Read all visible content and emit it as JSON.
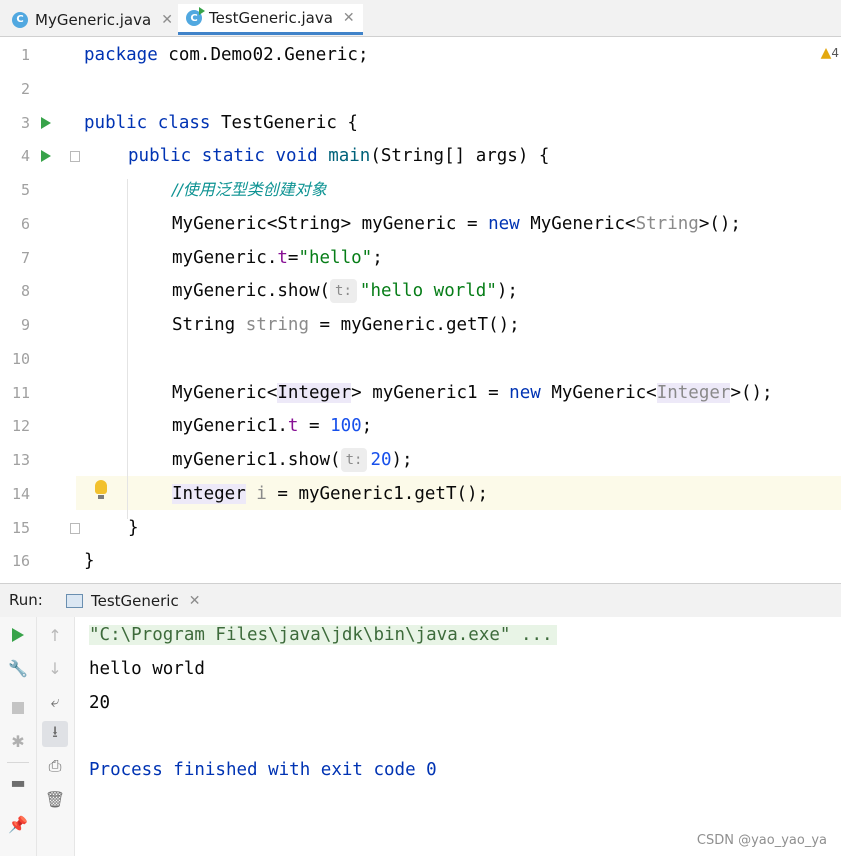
{
  "tabs": [
    {
      "label": "MyGeneric.java",
      "icon": "class-c-icon",
      "active": false
    },
    {
      "label": "TestGeneric.java",
      "icon": "runnable-class-icon",
      "active": true
    }
  ],
  "editor": {
    "warning_count": "4",
    "line_numbers": [
      "1",
      "2",
      "3",
      "4",
      "5",
      "6",
      "7",
      "8",
      "9",
      "10",
      "11",
      "12",
      "13",
      "14",
      "15",
      "16"
    ],
    "line1": {
      "kw": "package",
      "rest": " com.Demo02.Generic;"
    },
    "line3": {
      "kw": "public class",
      "rest": " TestGeneric {"
    },
    "line4": {
      "kw1": "public static void",
      "method": " main",
      "rest": "(String[] args) {"
    },
    "line5": {
      "comment": "//使用泛型类创建对象"
    },
    "line6": {
      "a": "MyGeneric<String> myGeneric = ",
      "kw": "new",
      "b": " MyGeneric<",
      "g": "String",
      "c": ">();"
    },
    "line7": {
      "a": "myGeneric.",
      "field": "t",
      "b": "=",
      "str": "\"hello\"",
      "c": ";"
    },
    "line8": {
      "a": "myGeneric.show(",
      "hint": "t:",
      "str": "\"hello world\"",
      "c": ");"
    },
    "line9": {
      "a": "String ",
      "var": "string",
      "b": " = myGeneric.getT();"
    },
    "line11": {
      "a": "MyGeneric<",
      "t1": "Integer",
      "b": "> myGeneric1 = ",
      "kw": "new",
      "c": " MyGeneric<",
      "t2": "Integer",
      "d": ">();"
    },
    "line12": {
      "a": "myGeneric1.",
      "field": "t",
      "b": " = ",
      "num": "100",
      "c": ";"
    },
    "line13": {
      "a": "myGeneric1.show(",
      "hint": "t:",
      "num": "20",
      "c": ");"
    },
    "line14": {
      "t": "Integer",
      "var": " i",
      "b": " = myGeneric1.getT();"
    },
    "line15": {
      "a": "}"
    },
    "line16": {
      "a": "}"
    }
  },
  "run_panel": {
    "label": "Run:",
    "tab_label": "TestGeneric",
    "console": {
      "command": "\"C:\\Program Files\\java\\jdk\\bin\\java.exe\" ...",
      "out1": "hello world",
      "out2": "20",
      "exit": "Process finished with exit code 0"
    }
  },
  "watermark": "CSDN @yao_yao_ya",
  "colors": {
    "keyword": "#0033b3",
    "string": "#067d17",
    "number": "#1750eb",
    "comment": "#0e9393",
    "field": "#871094",
    "run_green": "#38a34a"
  }
}
